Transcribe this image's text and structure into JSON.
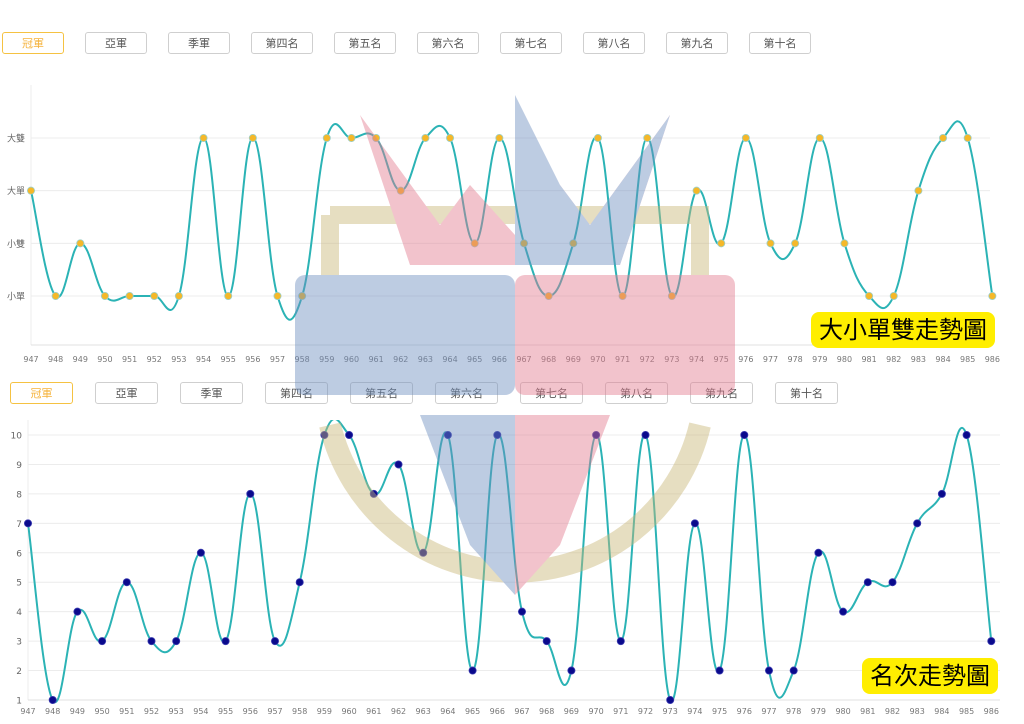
{
  "top_tabs": [
    "冠軍",
    "亞軍",
    "季軍",
    "第四名",
    "第五名",
    "第六名",
    "第七名",
    "第八名",
    "第九名",
    "第十名"
  ],
  "bottom_tabs": [
    "冠軍",
    "亞軍",
    "季軍",
    "第四名",
    "第五名",
    "第六名",
    "第七名",
    "第八名",
    "第九名",
    "第十名"
  ],
  "active_tab_index": 0,
  "colors": {
    "line": "#2bb3b5",
    "top_point": "#f5b829",
    "bottom_point": "#0a0a8c",
    "active_tab": "#f5c242",
    "badge": "#ffee00"
  },
  "badges": {
    "top": "大小單雙走勢圖",
    "bottom": "名次走勢圖"
  },
  "chart_data": [
    {
      "type": "line",
      "title": "大小單雙走勢圖",
      "x": [
        "947",
        "948",
        "949",
        "950",
        "951",
        "952",
        "953",
        "954",
        "955",
        "956",
        "957",
        "958",
        "959",
        "960",
        "961",
        "962",
        "963",
        "964",
        "965",
        "966",
        "967",
        "968",
        "969",
        "970",
        "971",
        "972",
        "973",
        "974",
        "975",
        "976",
        "977",
        "978",
        "979",
        "980",
        "981",
        "982",
        "983",
        "984",
        "985",
        "986"
      ],
      "y_categories": [
        "小單",
        "小雙",
        "大單",
        "大雙"
      ],
      "values": [
        3,
        1,
        2,
        1,
        1,
        1,
        1,
        4,
        1,
        4,
        1,
        1,
        4,
        4,
        4,
        3,
        4,
        4,
        2,
        4,
        2,
        1,
        2,
        4,
        1,
        4,
        1,
        3,
        2,
        4,
        2,
        2,
        4,
        2,
        1,
        1,
        3,
        4,
        4,
        1
      ],
      "ylim": [
        0.5,
        4
      ],
      "grid": true,
      "smooth": true
    },
    {
      "type": "line",
      "title": "名次走勢圖",
      "x": [
        "947",
        "948",
        "949",
        "950",
        "951",
        "952",
        "953",
        "954",
        "955",
        "956",
        "957",
        "958",
        "959",
        "960",
        "961",
        "962",
        "963",
        "964",
        "965",
        "966",
        "967",
        "968",
        "969",
        "970",
        "971",
        "972",
        "973",
        "974",
        "975",
        "976",
        "977",
        "978",
        "979",
        "980",
        "981",
        "982",
        "983",
        "984",
        "985",
        "986"
      ],
      "y_ticks": [
        1,
        2,
        3,
        4,
        5,
        6,
        7,
        8,
        9,
        10
      ],
      "values": [
        7,
        1,
        4,
        3,
        5,
        3,
        3,
        6,
        3,
        8,
        3,
        5,
        10,
        10,
        8,
        9,
        6,
        10,
        2,
        10,
        4,
        3,
        2,
        10,
        3,
        10,
        1,
        7,
        2,
        10,
        2,
        2,
        6,
        4,
        5,
        5,
        7,
        8,
        10,
        3
      ],
      "ylim": [
        1,
        10
      ],
      "grid": true,
      "smooth": true
    }
  ]
}
